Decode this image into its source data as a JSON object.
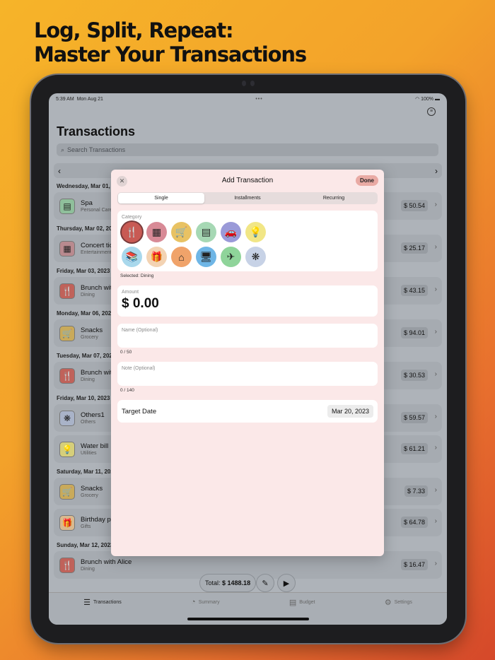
{
  "headline": {
    "line1": "Log, Split, Repeat:",
    "line2": "Master Your Transactions"
  },
  "status": {
    "time": "5:39 AM",
    "date": "Mon Aug 21",
    "battery": "100%"
  },
  "page": {
    "title": "Transactions",
    "search_placeholder": "Search Transactions"
  },
  "days": [
    {
      "header": "Wednesday, Mar 01, 2",
      "rows": [
        {
          "name": "Spa",
          "category": "Personal Care",
          "amount": "$ 50.54",
          "icon": "▤",
          "color": "#8fbf9b"
        }
      ]
    },
    {
      "header": "Thursday, Mar 02, 20",
      "rows": [
        {
          "name": "Concert tic",
          "category": "Entertainment",
          "amount": "$ 25.17",
          "icon": "▦",
          "color": "#b98a8f"
        }
      ]
    },
    {
      "header": "Friday, Mar 03, 2023",
      "rows": [
        {
          "name": "Brunch wit",
          "category": "Dining",
          "amount": "$ 43.15",
          "icon": "🍴",
          "color": "#c0625a"
        }
      ]
    },
    {
      "header": "Monday, Mar 06, 202",
      "rows": [
        {
          "name": "Snacks",
          "category": "Grocery",
          "amount": "$ 94.01",
          "icon": "🛒",
          "color": "#c9aa5a"
        }
      ]
    },
    {
      "header": "Tuesday, Mar 07, 202",
      "rows": [
        {
          "name": "Brunch wit",
          "category": "Dining",
          "amount": "$ 30.53",
          "icon": "🍴",
          "color": "#c0625a"
        }
      ]
    },
    {
      "header": "Friday, Mar 10, 2023",
      "rows": [
        {
          "name": "Others1",
          "category": "Others",
          "amount": "$ 59.57",
          "icon": "❋",
          "color": "#a9b3c8"
        },
        {
          "name": "Water bill",
          "category": "Utilities",
          "amount": "$ 61.21",
          "icon": "💡",
          "color": "#d6cf7a"
        }
      ]
    },
    {
      "header": "Saturday, Mar 11, 202",
      "rows": [
        {
          "name": "Snacks",
          "category": "Grocery",
          "amount": "$ 7.33",
          "icon": "🛒",
          "color": "#c9aa5a"
        },
        {
          "name": "Birthday pr",
          "category": "Gifts",
          "amount": "$ 64.78",
          "icon": "🎁",
          "color": "#d9b98f"
        }
      ]
    },
    {
      "header": "Sunday, Mar 12, 2023",
      "rows": [
        {
          "name": "Brunch with Alice",
          "category": "Dining",
          "amount": "$ 16.47",
          "icon": "🍴",
          "color": "#c0625a"
        }
      ]
    }
  ],
  "footer": {
    "total_label": "Total:",
    "total_value": "$ 1488.18"
  },
  "tabs": [
    {
      "label": "Transactions",
      "icon": "☰",
      "active": true
    },
    {
      "label": "Summary",
      "icon": "◔",
      "active": false
    },
    {
      "label": "Budget",
      "icon": "▤",
      "active": false
    },
    {
      "label": "Settings",
      "icon": "⚙",
      "active": false
    }
  ],
  "modal": {
    "title": "Add Transaction",
    "done": "Done",
    "segments": [
      "Single",
      "Installments",
      "Recurring"
    ],
    "category_label": "Category",
    "categories": [
      {
        "name": "dining",
        "icon": "🍴",
        "color": "#c85a54",
        "selected": true
      },
      {
        "name": "entertainment",
        "icon": "▦",
        "color": "#d88a96",
        "selected": false
      },
      {
        "name": "grocery",
        "icon": "🛒",
        "color": "#e8c263",
        "selected": false
      },
      {
        "name": "personal-care",
        "icon": "▤",
        "color": "#a6d8b4",
        "selected": false
      },
      {
        "name": "transport",
        "icon": "🚗",
        "color": "#9a9ad8",
        "selected": false
      },
      {
        "name": "utilities",
        "icon": "💡",
        "color": "#f1e686",
        "selected": false
      },
      {
        "name": "education",
        "icon": "📚",
        "color": "#a9d8ec",
        "selected": false
      },
      {
        "name": "gifts",
        "icon": "🎁",
        "color": "#f3d3b3",
        "selected": false
      },
      {
        "name": "housing",
        "icon": "⌂",
        "color": "#f0a36a",
        "selected": false
      },
      {
        "name": "electronics",
        "icon": "🖥",
        "color": "#6fb6e6",
        "selected": false
      },
      {
        "name": "travel",
        "icon": "✈",
        "color": "#8fd49a",
        "selected": false
      },
      {
        "name": "others",
        "icon": "❋",
        "color": "#c7d2e6",
        "selected": false
      }
    ],
    "selected_text": "Selected: Dining",
    "amount_label": "Amount",
    "amount_value": "$ 0.00",
    "name_placeholder": "Name (Optional)",
    "name_count": "0 / 50",
    "note_placeholder": "Note (Optional)",
    "note_count": "0 / 140",
    "target_label": "Target Date",
    "target_date": "Mar 20, 2023"
  }
}
